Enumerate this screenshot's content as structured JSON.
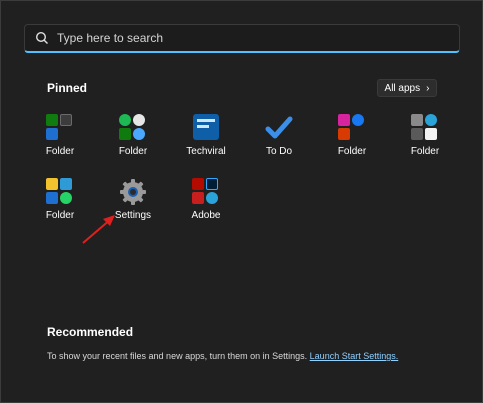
{
  "search": {
    "placeholder": "Type here to search"
  },
  "pinned": {
    "title": "Pinned",
    "all_apps_label": "All apps",
    "apps": [
      {
        "label": "Folder"
      },
      {
        "label": "Folder"
      },
      {
        "label": "Techviral"
      },
      {
        "label": "To Do"
      },
      {
        "label": "Folder"
      },
      {
        "label": "Folder"
      },
      {
        "label": "Folder"
      },
      {
        "label": "Settings"
      },
      {
        "label": "Adobe"
      }
    ]
  },
  "recommended": {
    "title": "Recommended",
    "text": "To show your recent files and new apps, turn them on in Settings.",
    "link": "Launch Start Settings."
  },
  "colors": {
    "accent": "#4cc2ff",
    "link": "#8fd0ff",
    "background": "#202020",
    "arrow": "#e0201f"
  }
}
